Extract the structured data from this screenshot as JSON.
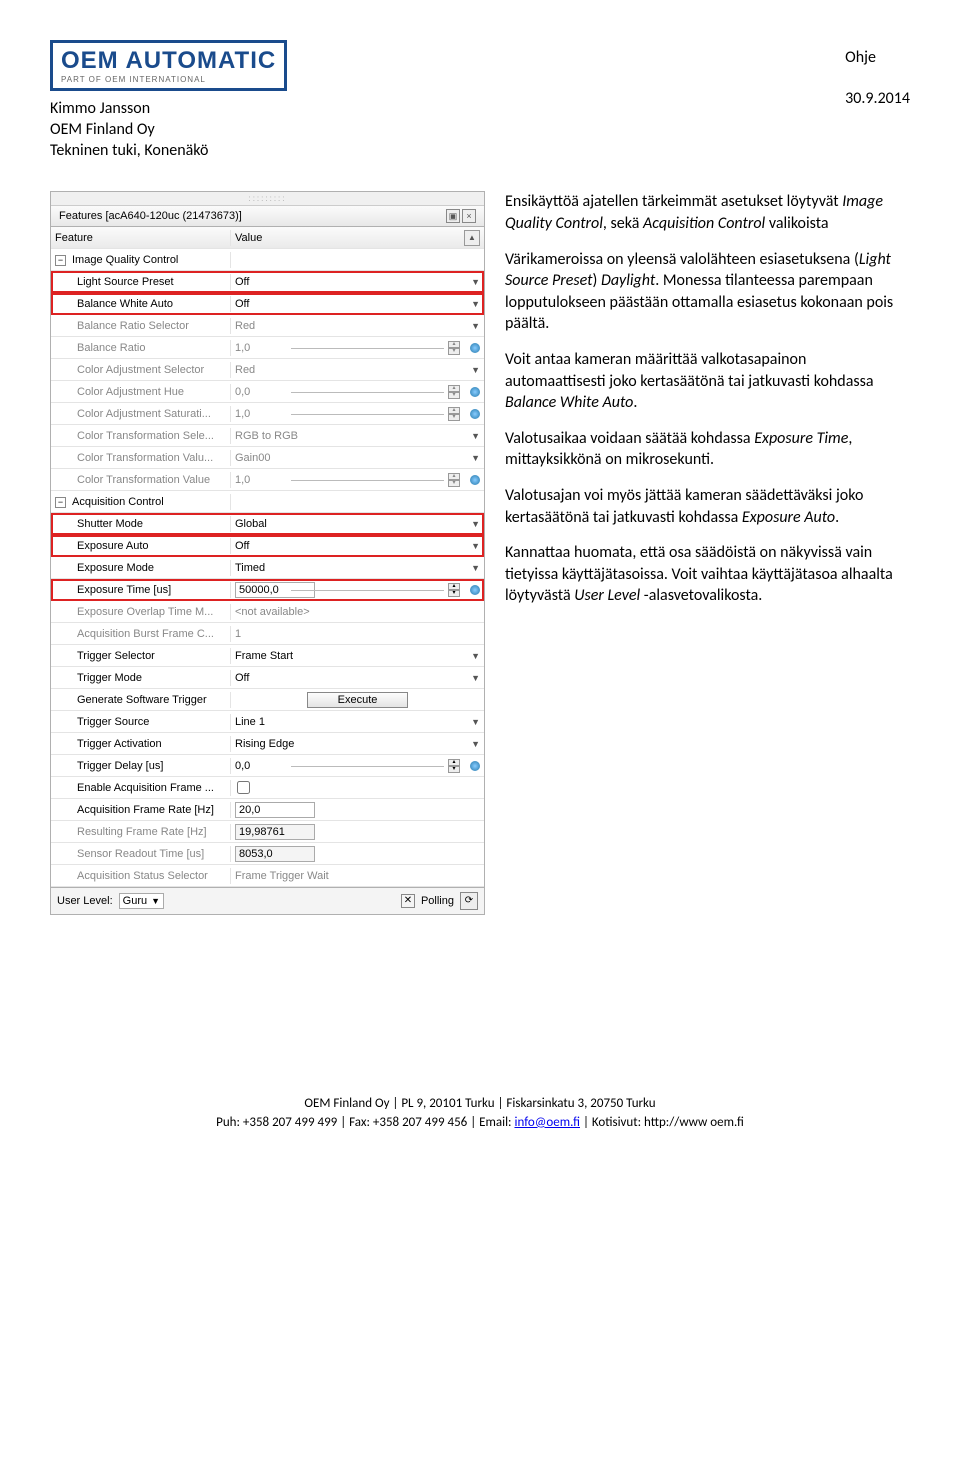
{
  "header": {
    "logo_top": "OEM AUTOMATIC",
    "logo_bottom": "PART OF OEM INTERNATIONAL",
    "name": "Kimmo Jansson",
    "company": "OEM Finland Oy",
    "dept": "Tekninen tuki, Konenäkö",
    "title": "Ohje",
    "date": "30.9.2014"
  },
  "panel": {
    "title": "Features [acA640-120uc (21473673)]",
    "col_feature": "Feature",
    "col_value": "Value"
  },
  "rows": {
    "iqc": "Image Quality Control",
    "lsp": {
      "l": "Light Source Preset",
      "v": "Off"
    },
    "bwa": {
      "l": "Balance White Auto",
      "v": "Off"
    },
    "brs": {
      "l": "Balance Ratio Selector",
      "v": "Red"
    },
    "br": {
      "l": "Balance Ratio",
      "v": "1,0"
    },
    "cas": {
      "l": "Color Adjustment Selector",
      "v": "Red"
    },
    "cah": {
      "l": "Color Adjustment Hue",
      "v": "0,0"
    },
    "casat": {
      "l": "Color Adjustment Saturati...",
      "v": "1,0"
    },
    "cts": {
      "l": "Color Transformation Sele...",
      "v": "RGB to RGB"
    },
    "ctv": {
      "l": "Color Transformation Valu...",
      "v": "Gain00"
    },
    "ctval": {
      "l": "Color Transformation Value",
      "v": "1,0"
    },
    "ac": "Acquisition Control",
    "sm": {
      "l": "Shutter Mode",
      "v": "Global"
    },
    "ea": {
      "l": "Exposure Auto",
      "v": "Off"
    },
    "em": {
      "l": "Exposure Mode",
      "v": "Timed"
    },
    "et": {
      "l": "Exposure Time [us]",
      "v": "50000,0"
    },
    "eot": {
      "l": "Exposure Overlap Time M...",
      "v": "<not available>"
    },
    "abf": {
      "l": "Acquisition Burst Frame C...",
      "v": "1"
    },
    "ts": {
      "l": "Trigger Selector",
      "v": "Frame Start"
    },
    "tm": {
      "l": "Trigger Mode",
      "v": "Off"
    },
    "gst": {
      "l": "Generate Software Trigger",
      "v": "Execute"
    },
    "tsrc": {
      "l": "Trigger Source",
      "v": "Line 1"
    },
    "ta": {
      "l": "Trigger Activation",
      "v": "Rising Edge"
    },
    "td": {
      "l": "Trigger Delay [us]",
      "v": "0,0"
    },
    "eaf": {
      "l": "Enable Acquisition Frame ...",
      "v": ""
    },
    "afr": {
      "l": "Acquisition Frame Rate [Hz]",
      "v": "20,0"
    },
    "rfr": {
      "l": "Resulting Frame Rate [Hz]",
      "v": "19,98761"
    },
    "srt": {
      "l": "Sensor Readout Time [us]",
      "v": "8053,0"
    },
    "acs": {
      "l": "Acquisition Status Selector",
      "v": "Frame Trigger Wait"
    }
  },
  "bottom": {
    "user_level_label": "User Level:",
    "user_level": "Guru",
    "polling": "Polling"
  },
  "explain": {
    "p1a": "Ensikäyttöä ajatellen tärkeimmät asetukset löytyvät ",
    "p1b": "Image Quality Control",
    "p1c": ", sekä ",
    "p1d": "Acquisition Control",
    "p1e": " valikoista",
    "p2a": "Värikameroissa on yleensä valolähteen esiasetuksena (",
    "p2b": "Light Source Preset",
    "p2c": ") ",
    "p2d": "Daylight",
    "p2e": ". Monessa tilanteessa parempaan lopputulokseen päästään ottamalla esiasetus kokonaan pois päältä.",
    "p3a": "Voit antaa kameran määrittää valkotasapainon automaattisesti joko kertasäätönä tai jatkuvasti kohdassa ",
    "p3b": "Balance White Auto",
    "p3c": ".",
    "p4a": "Valotusaikaa voidaan säätää kohdassa ",
    "p4b": "Exposure Time",
    "p4c": ", mittayksikkönä on mikrosekunti.",
    "p5a": "Valotusajan voi myös jättää kameran säädettäväksi joko kertasäätönä tai jatkuvasti kohdassa ",
    "p5b": "Exposure Auto",
    "p5c": ".",
    "p6a": "Kannattaa huomata, että osa säädöistä on näkyvissä vain tietyissa käyttäjätasoissa. Voit vaihtaa käyttäjätasoa alhaalta löytyvästä ",
    "p6b": "User Level",
    "p6c": " -alasvetovalikosta."
  },
  "footer": {
    "line1": "OEM Finland Oy | PL 9, 20101 Turku | Fiskarsinkatu 3, 20750 Turku",
    "line2a": "Puh: +358 207 499 499 | Fax: +358 207 499 456 | Email: ",
    "email": "info@oem.fi",
    "line2b": " | Kotisivut: http://www oem.fi"
  }
}
